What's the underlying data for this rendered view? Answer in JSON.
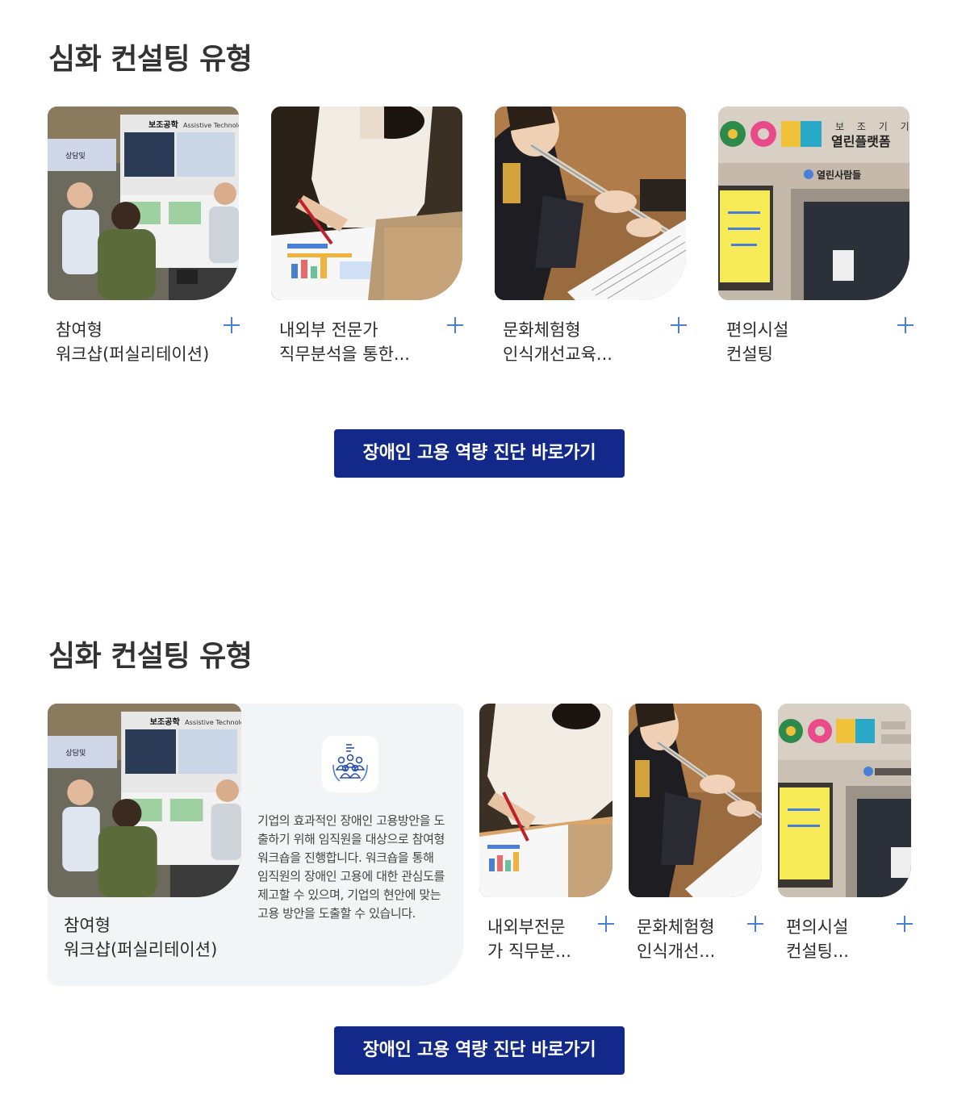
{
  "section1": {
    "title": "심화 컨설팅 유형",
    "cards": [
      {
        "line1": "참여형",
        "line2": "워크샵(퍼실리테이션)",
        "image": "booth-photo"
      },
      {
        "line1": "내외부 전문가",
        "line2": "직무분석을 통한...",
        "image": "analysis-photo"
      },
      {
        "line1": "문화체험형",
        "line2": "인식개선교육...",
        "image": "flute-photo"
      },
      {
        "line1": "편의시설",
        "line2": "컨설팅",
        "image": "platform-photo"
      }
    ],
    "cta_label": "장애인 고용 역량 진단 바로가기"
  },
  "section2": {
    "title": "심화 컨설팅 유형",
    "expanded": {
      "line1": "참여형",
      "line2": "워크샵(퍼실리테이션)",
      "description": "기업의 효과적인 장애인 고용방안을 도출하기 위해 임직원을 대상으로 참여형 워크숍을 진행합니다. 워크숍을 통해 임직원의 장애인 고용에 대한 관심도를 제고할 수 있으며, 기업의 현안에 맞는 고용 방안을 도출할 수 있습니다.",
      "icon": "group-people-icon"
    },
    "cards": [
      {
        "line1": "내외부전문",
        "line2": "가 직무분...",
        "image": "analysis-photo"
      },
      {
        "line1": "문화체험형",
        "line2": "인식개선...",
        "image": "flute-photo"
      },
      {
        "line1": "편의시설",
        "line2": "컨설팅...",
        "image": "platform-photo"
      }
    ],
    "cta_label": "장애인 고용 역량 진단 바로가기"
  },
  "image_text": {
    "booth_sign": "보조공학",
    "booth_sign_en": "Assistive Technolo",
    "booth_sub": "상담및",
    "platform_side": "보 조 기 기",
    "platform_name": "열린플랫폼",
    "platform_people": "열린사람들"
  },
  "colors": {
    "cta_bg": "#12298a",
    "plus": "#4a7fd8",
    "expanded_bg": "#f3f4f6"
  }
}
